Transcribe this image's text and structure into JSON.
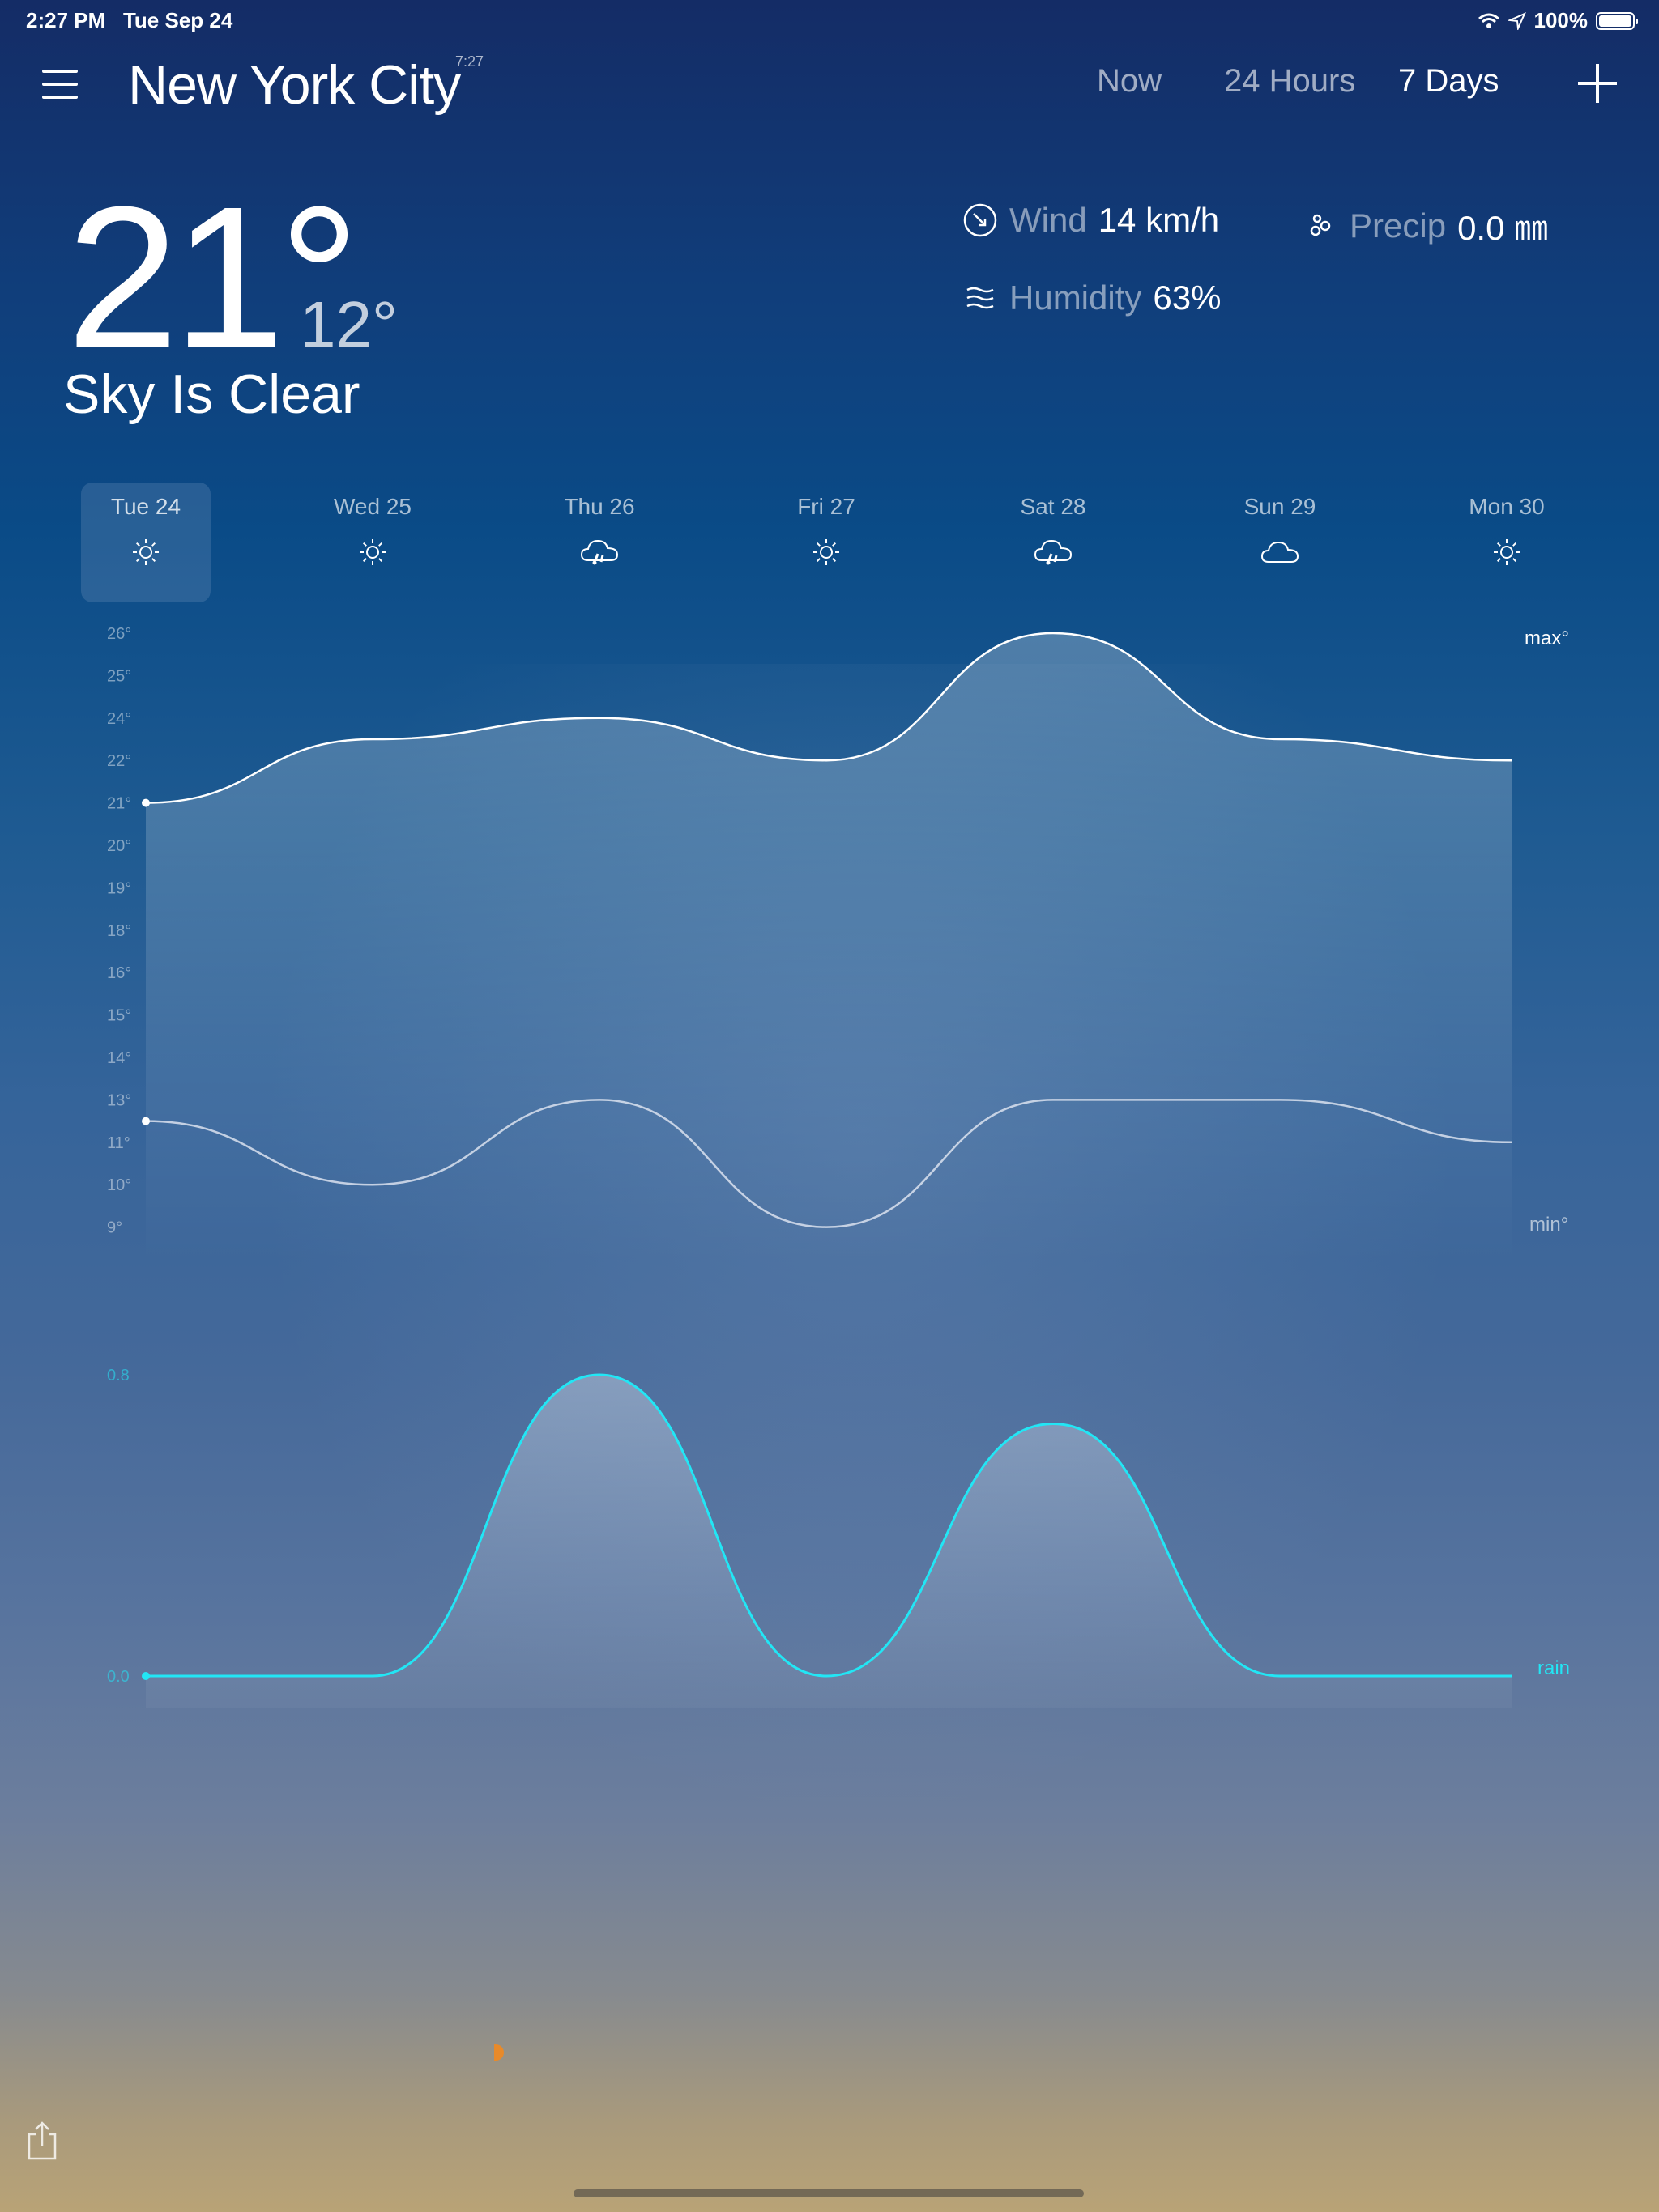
{
  "status_bar": {
    "time": "2:27 PM",
    "date": "Tue Sep 24",
    "battery": "100%",
    "battery_level": 1.0
  },
  "header": {
    "city": "New York City",
    "local_time": "7:27",
    "tabs": [
      {
        "label": "Now"
      },
      {
        "label": "24 Hours"
      },
      {
        "label": "7 Days",
        "active": true
      }
    ]
  },
  "current": {
    "temp": "21°",
    "low": "12°",
    "condition": "Sky Is Clear",
    "wind": {
      "label": "Wind",
      "value": "14 km/h"
    },
    "precip": {
      "label": "Precip",
      "value": "0.0 ㎜"
    },
    "humidity": {
      "label": "Humidity",
      "value": "63%"
    }
  },
  "days": [
    {
      "label": "Tue 24",
      "icon": "sun-icon",
      "selected": true
    },
    {
      "label": "Wed 25",
      "icon": "sun-icon"
    },
    {
      "label": "Thu 26",
      "icon": "rain-cloud-icon"
    },
    {
      "label": "Fri 27",
      "icon": "sun-icon"
    },
    {
      "label": "Sat 28",
      "icon": "rain-cloud-icon"
    },
    {
      "label": "Sun 29",
      "icon": "cloud-icon"
    },
    {
      "label": "Mon 30",
      "icon": "sun-icon"
    }
  ],
  "chart_data": {
    "type": "line",
    "categories": [
      "Tue 24",
      "Wed 25",
      "Thu 26",
      "Fri 27",
      "Sat 28",
      "Sun 29",
      "Mon 30"
    ],
    "temp_ticks": [
      "26°",
      "25°",
      "24°",
      "22°",
      "21°",
      "20°",
      "19°",
      "18°",
      "16°",
      "15°",
      "14°",
      "13°",
      "11°",
      "10°",
      "9°"
    ],
    "rain_ticks": [
      "0.8",
      "0.0"
    ],
    "series": [
      {
        "name": "max°",
        "values": [
          21,
          23,
          24,
          22,
          26,
          23,
          22
        ]
      },
      {
        "name": "min°",
        "values": [
          12,
          10,
          13,
          9,
          13,
          13,
          11
        ]
      },
      {
        "name": "rain",
        "values": [
          0.0,
          0.0,
          0.8,
          0.0,
          0.67,
          0.0,
          0.0
        ]
      }
    ],
    "colors": {
      "max": "#ffffff",
      "min": "#dbe2ee",
      "rain": "#22e6f5"
    }
  }
}
